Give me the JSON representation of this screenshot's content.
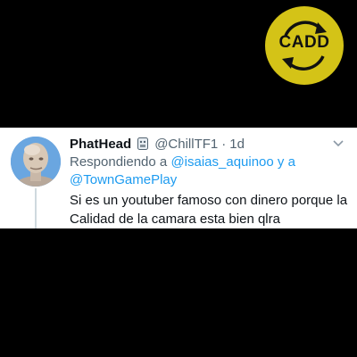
{
  "logo": {
    "text": "CADD",
    "icon": "sync-arrows-icon",
    "color": "#d4c317"
  },
  "tweet": {
    "display_name": "PhatHead",
    "badge_icon": "rage-face-badge-icon",
    "handle": "@ChillTF1",
    "separator": "·",
    "time": "1d",
    "reply_prefix": "Respondiendo a",
    "mention_1": "@isaias_aquinoo",
    "mention_joiner": "y a",
    "mention_2": "@TownGamePlay",
    "text": "Si es un youtuber famoso con dinero porque la Calidad de la camara esta bien qlra",
    "avatar_icon": "meme-man-avatar",
    "more_icon": "chevron-down-icon"
  },
  "colors": {
    "background": "#000000",
    "card": "#ffffff",
    "link": "#1d9bf0",
    "secondary_text": "#536471",
    "primary_text": "#0f1419"
  }
}
